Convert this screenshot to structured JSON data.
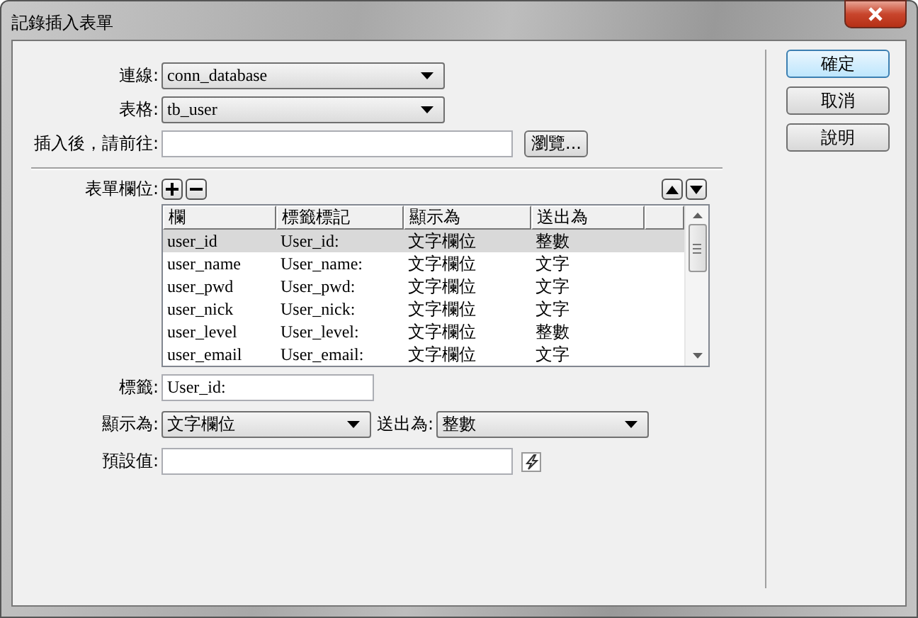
{
  "window": {
    "title": "記錄插入表單"
  },
  "connection": {
    "label": "連線:",
    "value": "conn_database"
  },
  "table_select": {
    "label": "表格:",
    "value": "tb_user"
  },
  "redirect": {
    "label": "插入後，請前往:",
    "browse_button": "瀏覽..."
  },
  "form_fields": {
    "label": "表單欄位:"
  },
  "grid": {
    "columns": [
      "欄",
      "標籤標記",
      "顯示為",
      "送出為"
    ],
    "rows": [
      {
        "cells": [
          "user_id",
          "User_id:",
          "文字欄位",
          "整數"
        ],
        "selected": true
      },
      {
        "cells": [
          "user_name",
          "User_name:",
          "文字欄位",
          "文字"
        ],
        "selected": false
      },
      {
        "cells": [
          "user_pwd",
          "User_pwd:",
          "文字欄位",
          "文字"
        ],
        "selected": false
      },
      {
        "cells": [
          "user_nick",
          "User_nick:",
          "文字欄位",
          "文字"
        ],
        "selected": false
      },
      {
        "cells": [
          "user_level",
          "User_level:",
          "文字欄位",
          "整數"
        ],
        "selected": false
      },
      {
        "cells": [
          "user_email",
          "User_email:",
          "文字欄位",
          "文字"
        ],
        "selected": false
      }
    ]
  },
  "label_field": {
    "label": "標籤:",
    "value": "User_id:"
  },
  "display_as": {
    "label": "顯示為:",
    "value": "文字欄位"
  },
  "submit_as": {
    "label": "送出為:",
    "value": "整數"
  },
  "default_value": {
    "label": "預設值:"
  },
  "buttons": [
    {
      "label": "確定",
      "default": true
    },
    {
      "label": "取消",
      "default": false
    },
    {
      "label": "說明",
      "default": false
    }
  ]
}
